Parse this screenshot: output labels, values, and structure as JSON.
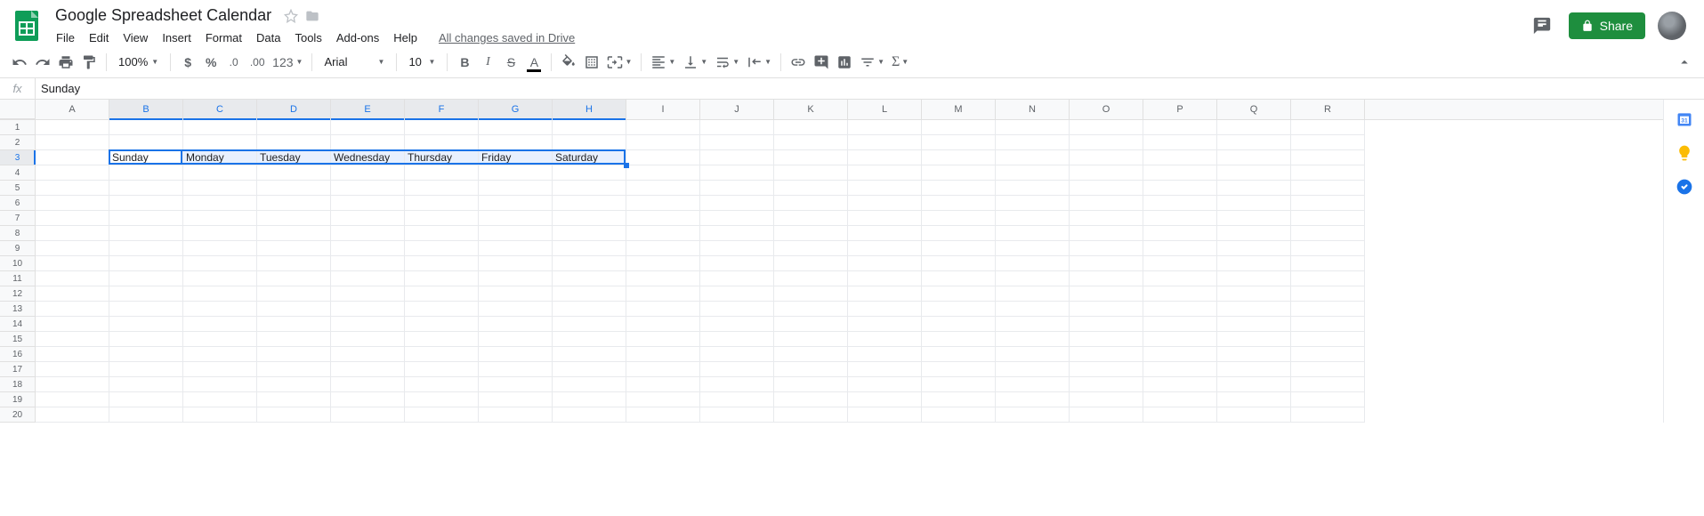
{
  "header": {
    "doc_title": "Google Spreadsheet Calendar",
    "menu": [
      "File",
      "Edit",
      "View",
      "Insert",
      "Format",
      "Data",
      "Tools",
      "Add-ons",
      "Help"
    ],
    "save_status": "All changes saved in Drive",
    "share_label": "Share"
  },
  "toolbar": {
    "zoom": "100%",
    "font": "Arial",
    "font_size": "10",
    "num_format": "123"
  },
  "formula_bar": {
    "fx": "fx",
    "value": "Sunday"
  },
  "grid": {
    "columns": [
      "A",
      "B",
      "C",
      "D",
      "E",
      "F",
      "G",
      "H",
      "I",
      "J",
      "K",
      "L",
      "M",
      "N",
      "O",
      "P",
      "Q",
      "R"
    ],
    "row_count": 20,
    "selected_cols": [
      "B",
      "C",
      "D",
      "E",
      "F",
      "G",
      "H"
    ],
    "selected_row": 3,
    "active_cell": "B3",
    "cells": {
      "B3": "Sunday",
      "C3": "Monday",
      "D3": "Tuesday",
      "E3": "Wednesday",
      "F3": "Thursday",
      "G3": "Friday",
      "H3": "Saturday"
    }
  }
}
